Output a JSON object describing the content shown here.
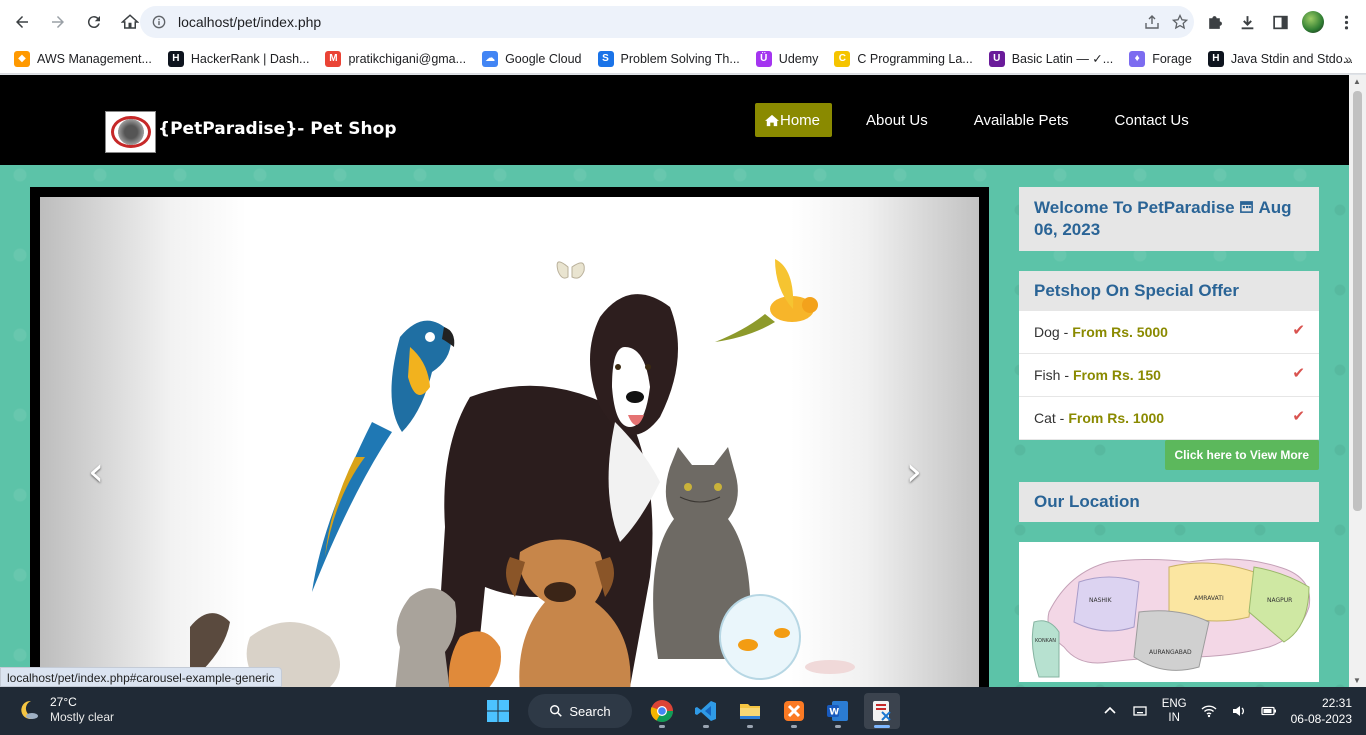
{
  "browser": {
    "url": "localhost/pet/index.php",
    "bookmarks": [
      {
        "label": "AWS Management...",
        "icon": "aws-icon",
        "color": "#ff9900"
      },
      {
        "label": "HackerRank | Dash...",
        "icon": "hackerrank-icon",
        "color": "#0e141e"
      },
      {
        "label": "pratikchigani@gma...",
        "icon": "gmail-icon",
        "color": "#ea4335"
      },
      {
        "label": "Google Cloud",
        "icon": "google-cloud-icon",
        "color": "#4285f4"
      },
      {
        "label": "Problem Solving Th...",
        "icon": "s-icon",
        "color": "#1a73e8"
      },
      {
        "label": "Udemy",
        "icon": "udemy-icon",
        "color": "#a435f0"
      },
      {
        "label": "C Programming La...",
        "icon": "c-icon",
        "color": "#f5c400"
      },
      {
        "label": "Basic Latin — ✓...",
        "icon": "unicode-icon",
        "color": "#6a1b9a"
      },
      {
        "label": "Forage",
        "icon": "forage-icon",
        "color": "#7c6cf0"
      },
      {
        "label": "Java Stdin and Stdo...",
        "icon": "hackerrank-icon",
        "color": "#0e141e"
      }
    ]
  },
  "site": {
    "brand": "{PetParadise}- Pet Shop",
    "nav": [
      "Home",
      "About Us",
      "Available Pets",
      "Contact Us"
    ],
    "welcome_text": "Welcome To PetParadise",
    "date": "Aug 06, 2023",
    "offer_title": "Petshop On Special Offer",
    "offers": [
      {
        "pet": "Dog -",
        "price": "From Rs. 5000"
      },
      {
        "pet": "Fish -",
        "price": "From Rs. 150"
      },
      {
        "pet": "Cat -",
        "price": "From Rs. 1000"
      }
    ],
    "view_more": "Click here to View More",
    "location_title": "Our Location",
    "map_labels": [
      "NASHIK",
      "AMRAVATI",
      "NAGPUR",
      "AURANGABAD",
      "KONKAN"
    ]
  },
  "status_url": "localhost/pet/index.php#carousel-example-generic",
  "taskbar": {
    "temp": "27°C",
    "weather": "Mostly clear",
    "search": "Search",
    "lang_top": "ENG",
    "lang_bottom": "IN",
    "time": "22:31",
    "date": "06-08-2023"
  },
  "colors": {
    "page_bg": "#5cc3a8",
    "accent_olive": "#8a8a00",
    "heading_blue": "#2a6496",
    "check_red": "#d9534f",
    "button_green": "#5cb85c"
  }
}
